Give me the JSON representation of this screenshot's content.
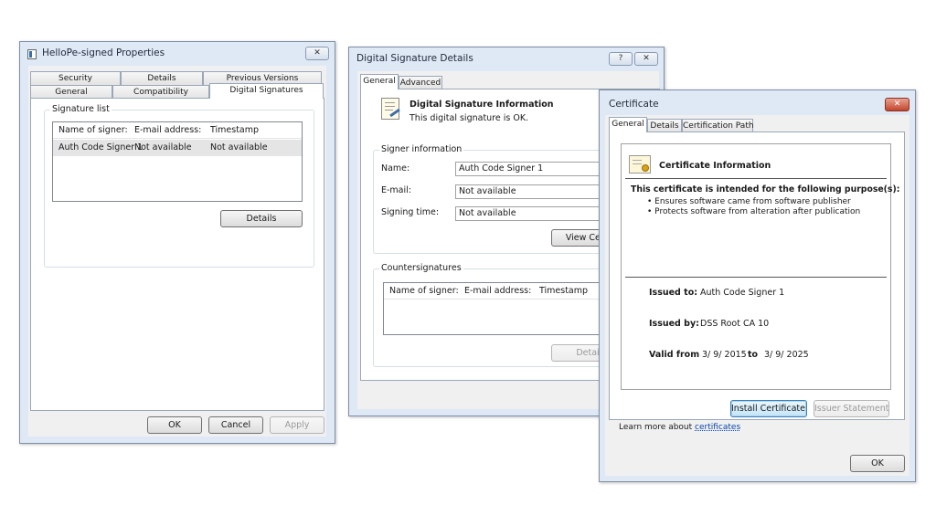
{
  "properties": {
    "title": "HelloPe-signed Properties",
    "close": "✕",
    "tabs_row1": [
      "Security",
      "Details",
      "Previous Versions"
    ],
    "tabs_row2": [
      "General",
      "Compatibility",
      "Digital Signatures"
    ],
    "signature_list_label": "Signature list",
    "columns": [
      "Name of signer:",
      "E-mail address:",
      "Timestamp"
    ],
    "rows": [
      [
        "Auth Code Signer 1",
        "Not available",
        "Not available"
      ]
    ],
    "details_button": "Details",
    "ok_button": "OK",
    "cancel_button": "Cancel",
    "apply_button": "Apply"
  },
  "dsd": {
    "title": "Digital Signature Details",
    "help": "?",
    "close": "✕",
    "tabs": [
      "General",
      "Advanced"
    ],
    "info_title": "Digital Signature Information",
    "info_status": "This digital signature is OK.",
    "signer_group": "Signer information",
    "name_label": "Name:",
    "name_value": "Auth Code Signer 1",
    "email_label": "E-mail:",
    "email_value": "Not available",
    "time_label": "Signing time:",
    "time_value": "Not available",
    "view_cert_button": "View Certi",
    "counter_group": "Countersignatures",
    "counter_columns": [
      "Name of signer:",
      "E-mail address:",
      "Timestamp"
    ],
    "details_button": "Detai"
  },
  "cert": {
    "title": "Certificate",
    "close": "✕",
    "tabs": [
      "General",
      "Details",
      "Certification Path"
    ],
    "info_title": "Certificate Information",
    "purpose_heading": "This certificate is intended for the following purpose(s):",
    "purposes": [
      "Ensures software came from software publisher",
      "Protects software from alteration after publication"
    ],
    "issued_to_label": "Issued to:",
    "issued_to_value": "Auth Code Signer 1",
    "issued_by_label": "Issued by:",
    "issued_by_value": "DSS Root CA 10",
    "valid_from_label": "Valid from",
    "valid_from_value": "3/ 9/ 2015",
    "valid_to_label": "to",
    "valid_to_value": "3/ 9/ 2025",
    "install_button": "Install Certificate...",
    "issuer_button": "Issuer Statement",
    "learn_more_text": "Learn more about",
    "learn_more_link": "certificates",
    "ok_button": "OK"
  }
}
